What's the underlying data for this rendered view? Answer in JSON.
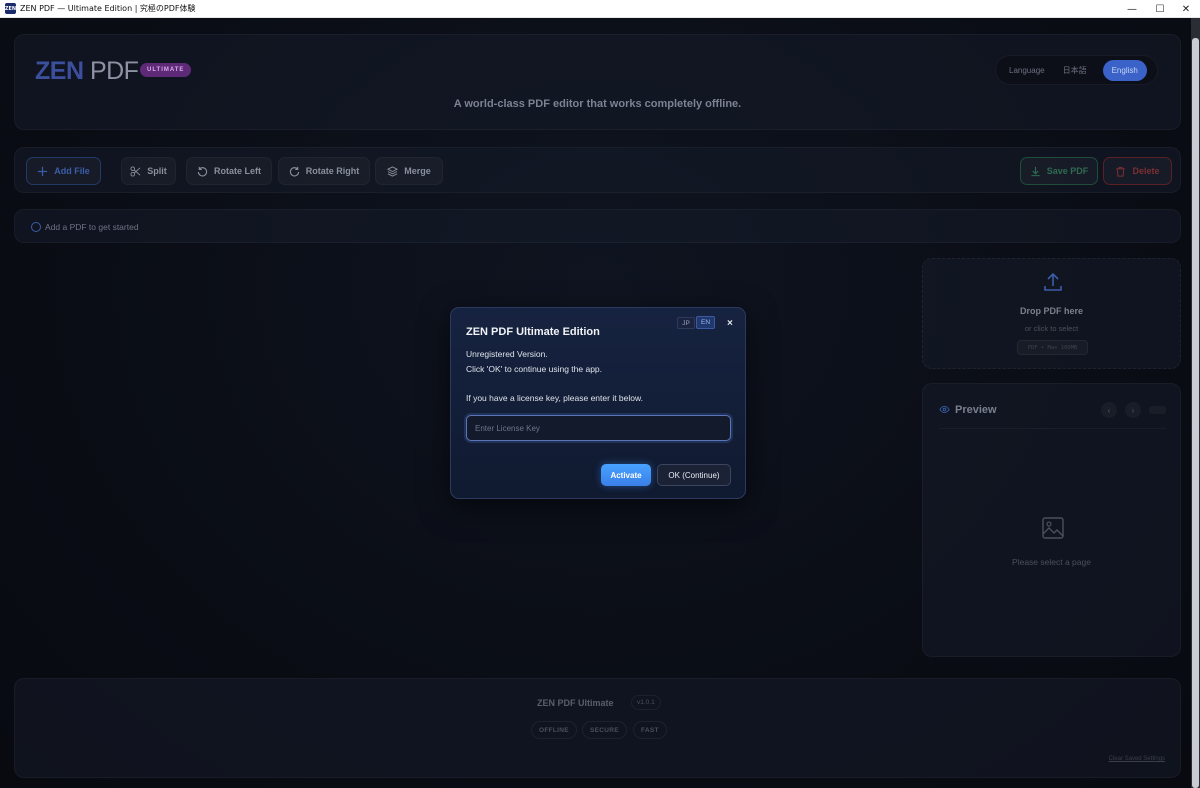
{
  "window": {
    "title": "ZEN PDF — Ultimate Edition | 究極のPDF体験",
    "icon_label": "ZEN",
    "minimize": "—",
    "maximize": "☐",
    "close": "✕"
  },
  "header": {
    "logo_zen": "ZEN",
    "logo_pdf": "PDF",
    "badge": "ULTIMATE",
    "tagline": "A world-class PDF editor that works completely offline.",
    "language_label": "Language",
    "lang_jp": "日本語",
    "lang_en": "English"
  },
  "toolbar": {
    "add_file": "Add File",
    "split": "Split",
    "rotate_left": "Rotate Left",
    "rotate_right": "Rotate Right",
    "merge": "Merge",
    "save_pdf": "Save PDF",
    "delete": "Delete"
  },
  "status": {
    "message": "Add a PDF to get started"
  },
  "dropzone": {
    "title": "Drop PDF here",
    "subtitle": "or click to select",
    "hint": "PDF • Max 100MB"
  },
  "preview": {
    "title": "Preview",
    "prev": "‹",
    "next": "›",
    "empty": "Please select a page"
  },
  "footer": {
    "name": "ZEN PDF Ultimate",
    "version": "v1.0.1",
    "chips": [
      "OFFLINE",
      "SECURE",
      "FAST"
    ],
    "clear_link": "Clear Saved Settings"
  },
  "modal": {
    "title": "ZEN PDF Ultimate Edition",
    "lang_jp": "JP",
    "lang_en": "EN",
    "close": "×",
    "line1": "Unregistered Version.",
    "line2": "Click 'OK' to continue using the app.",
    "line3": "If you have a license key, please enter it below.",
    "license_placeholder": "Enter License Key",
    "activate": "Activate",
    "ok": "OK (Continue)"
  },
  "colors": {
    "accent_blue": "#3a62c8",
    "activate_blue": "#48a2ff",
    "badge_purple": "#5e2a78",
    "save_green": "#2f6b52",
    "delete_red": "#7c2f33"
  }
}
